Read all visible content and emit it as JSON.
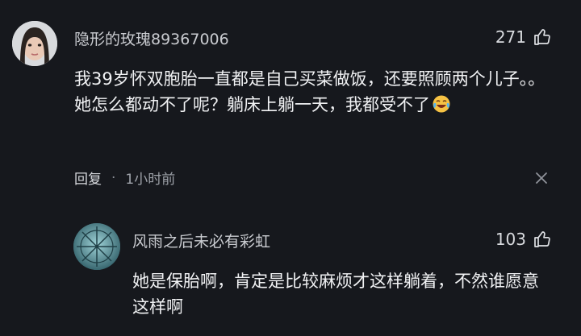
{
  "comment": {
    "username": "隐形的玫瑰89367006",
    "likes": "271",
    "text": "我39岁怀双胞胎一直都是自己买菜做饭，还要照顾两个儿子。。她怎么都动不了呢？躺床上躺一天，我都受不了",
    "reply_label": "回复",
    "separator": "·",
    "time": "1小时前",
    "icons": {
      "like": "thumbs-up-icon",
      "emoji": "laughing-crying-emoji",
      "dismiss": "close-icon"
    }
  },
  "reply": {
    "username": "风雨之后未必有彩虹",
    "likes": "103",
    "text": "她是保胎啊，肯定是比较麻烦才这样躺着，不然谁愿意这样啊",
    "icons": {
      "like": "thumbs-up-icon"
    }
  },
  "colors": {
    "background": "#16181d",
    "text": "#f1f2f4",
    "muted": "#9ea2a9"
  }
}
